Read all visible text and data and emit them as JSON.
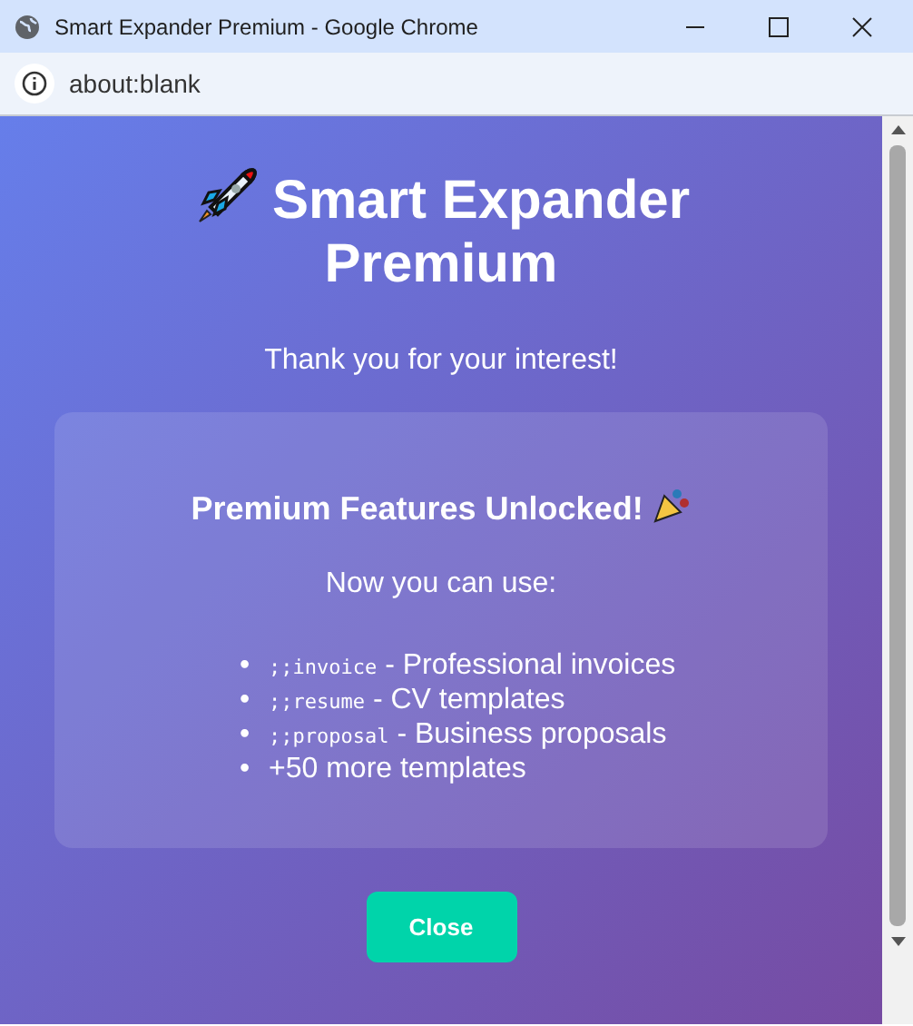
{
  "window": {
    "title": "Smart Expander Premium - Google Chrome"
  },
  "address_bar": {
    "url": "about:blank"
  },
  "page": {
    "heading": "Smart Expander Premium",
    "subtitle": "Thank you for your interest!",
    "card": {
      "title": "Premium Features Unlocked!",
      "intro": "Now you can use:",
      "features": [
        {
          "bullet": "•",
          "code": ";;invoice",
          "text": "- Professional invoices"
        },
        {
          "bullet": "•",
          "code": ";;resume",
          "text": "- CV templates"
        },
        {
          "bullet": "•",
          "code": ";;proposal",
          "text": "- Business proposals"
        },
        {
          "bullet": "•",
          "text": "+50 more templates"
        }
      ]
    },
    "button": "Close"
  }
}
